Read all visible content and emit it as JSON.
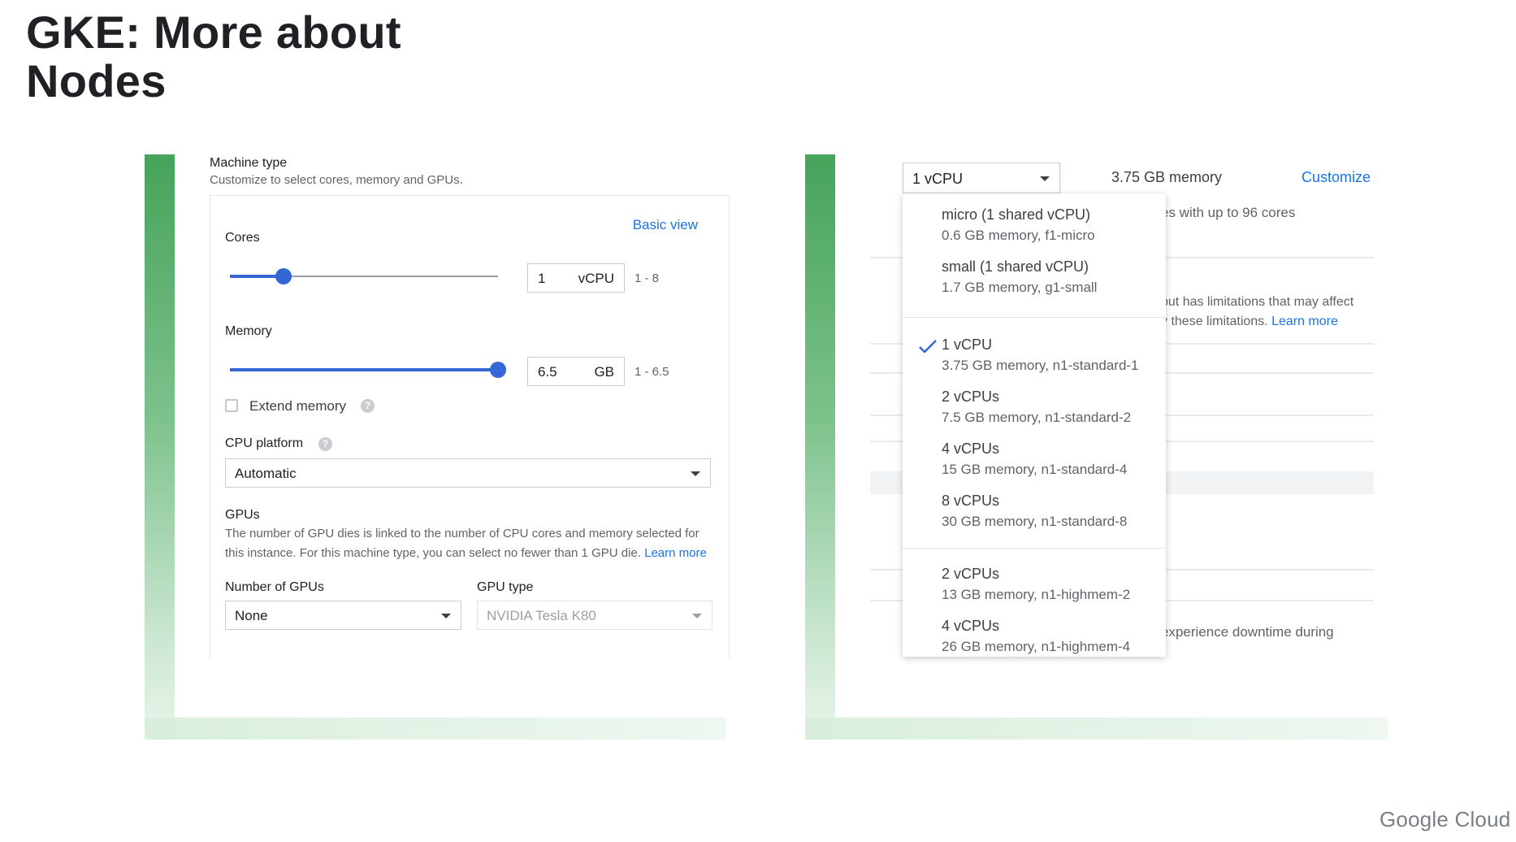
{
  "slide": {
    "title_line1": "GKE: More about",
    "title_line2": "Nodes",
    "logo": "Google Cloud"
  },
  "left": {
    "title": "Machine type",
    "subtitle": "Customize to select cores, memory and GPUs.",
    "basic_view": "Basic view",
    "cores": {
      "label": "Cores",
      "value": "1",
      "unit": "vCPU",
      "range": "1 - 8",
      "slider_fraction": 0.2
    },
    "memory": {
      "label": "Memory",
      "value": "6.5",
      "unit": "GB",
      "range": "1 - 6.5",
      "slider_fraction": 1.0
    },
    "extend_memory": "Extend memory",
    "cpu_platform": {
      "label": "CPU platform",
      "value": "Automatic"
    },
    "gpus": {
      "label": "GPUs",
      "description": "The number of GPU dies is linked to the number of CPU cores and memory selected for this instance. For this machine type, you can select no fewer than 1 GPU die.",
      "learn_more": "Learn more",
      "number_label": "Number of GPUs",
      "number_value": "None",
      "type_label": "GPU type",
      "type_value": "NVIDIA Tesla K80"
    }
  },
  "right": {
    "selected": "1 vCPU",
    "memory_label": "3.75 GB memory",
    "customize": "Customize",
    "bg_text_1": "es with up to 96 cores",
    "bg_text_2": "but has limitations that may affect",
    "bg_text_3": "y these limitations.",
    "bg_learn_more": "Learn more",
    "bg_text_4": "experience downtime during",
    "options": [
      {
        "name": "micro (1 shared vCPU)",
        "desc": "0.6 GB memory, f1-micro",
        "selected": false
      },
      {
        "name": "small (1 shared vCPU)",
        "desc": "1.7 GB memory, g1-small",
        "selected": false
      },
      {
        "name": "1 vCPU",
        "desc": "3.75 GB memory, n1-standard-1",
        "selected": true
      },
      {
        "name": "2 vCPUs",
        "desc": "7.5 GB memory, n1-standard-2",
        "selected": false
      },
      {
        "name": "4 vCPUs",
        "desc": "15 GB memory, n1-standard-4",
        "selected": false
      },
      {
        "name": "8 vCPUs",
        "desc": "30 GB memory, n1-standard-8",
        "selected": false
      },
      {
        "name": "2 vCPUs",
        "desc": "13 GB memory, n1-highmem-2",
        "selected": false
      },
      {
        "name": "4 vCPUs",
        "desc": "26 GB memory, n1-highmem-4",
        "selected": false
      }
    ]
  },
  "colors": {
    "accent": "#1a73e8",
    "slider": "#3367d6",
    "frame_green": "#46a35a"
  }
}
